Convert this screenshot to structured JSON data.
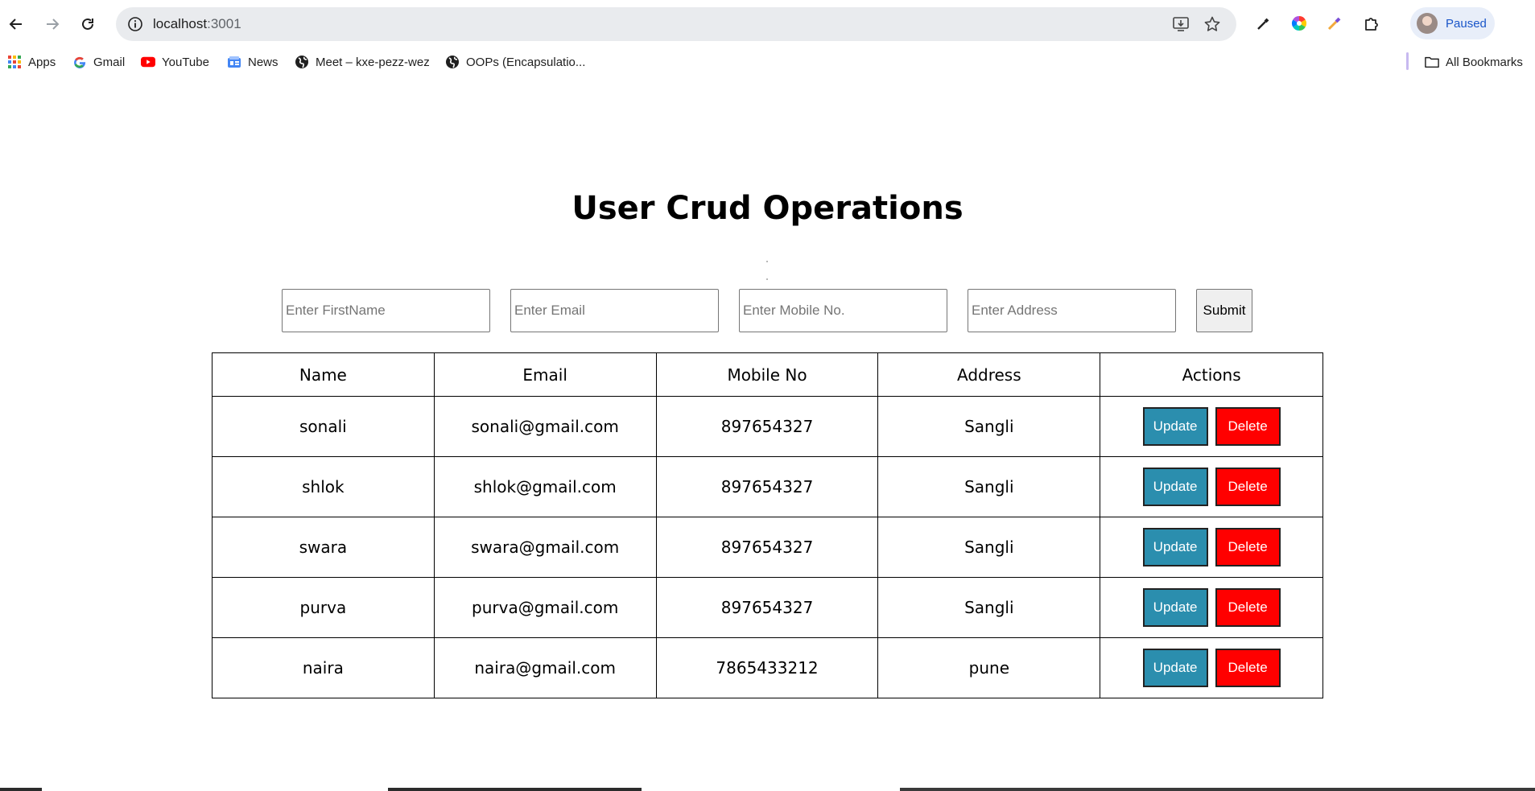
{
  "browser": {
    "url_host": "localhost",
    "url_port": ":3001",
    "profile_label": "Paused",
    "bookmarks": [
      {
        "label": "Apps",
        "icon": "apps-grid-icon"
      },
      {
        "label": "Gmail",
        "icon": "google-icon"
      },
      {
        "label": "YouTube",
        "icon": "youtube-icon"
      },
      {
        "label": "News",
        "icon": "news-icon"
      },
      {
        "label": "Meet – kxe-pezz-wez",
        "icon": "globe-icon"
      },
      {
        "label": "OOPs (Encapsulatio...",
        "icon": "globe-icon"
      }
    ],
    "all_bookmarks_label": "All Bookmarks"
  },
  "page": {
    "title": "User Crud Operations",
    "form": {
      "firstname_placeholder": "Enter FirstName",
      "email_placeholder": "Enter Email",
      "mobile_placeholder": "Enter Mobile No.",
      "address_placeholder": "Enter Address",
      "submit_label": "Submit"
    },
    "table": {
      "headers": [
        "Name",
        "Email",
        "Mobile No",
        "Address",
        "Actions"
      ],
      "rows": [
        {
          "name": "sonali",
          "email": "sonali@gmail.com",
          "mobile": "897654327",
          "address": "Sangli"
        },
        {
          "name": "shlok",
          "email": "shlok@gmail.com",
          "mobile": "897654327",
          "address": "Sangli"
        },
        {
          "name": "swara",
          "email": "swara@gmail.com",
          "mobile": "897654327",
          "address": "Sangli"
        },
        {
          "name": "purva",
          "email": "purva@gmail.com",
          "mobile": "897654327",
          "address": "Sangli"
        },
        {
          "name": "naira",
          "email": "naira@gmail.com",
          "mobile": "7865433212",
          "address": "pune"
        }
      ],
      "update_label": "Update",
      "delete_label": "Delete"
    }
  },
  "colors": {
    "update_button": "#2b8eae",
    "delete_button": "#ff0000",
    "omnibox": "#e9ebee",
    "profile_text": "#1a56c9"
  }
}
